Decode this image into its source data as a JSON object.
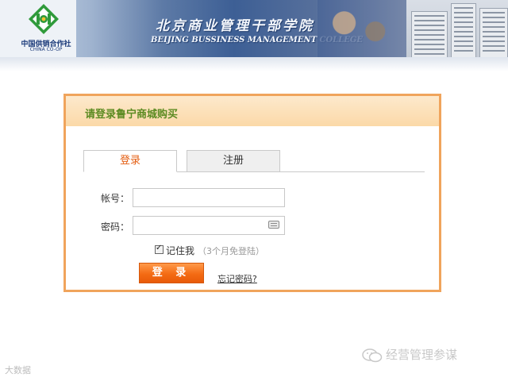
{
  "banner": {
    "coop_name_cn": "中国供销合作社",
    "coop_name_en": "CHINA CO-OP",
    "college_name_cn": "北京商业管理干部学院",
    "college_name_en": "BEIJING BUSSINESS MANAGEMENT COLLEGE"
  },
  "login_panel": {
    "title": "请登录鲁宁商城购买",
    "tabs": [
      {
        "label": "登录",
        "active": true
      },
      {
        "label": "注册",
        "active": false
      }
    ],
    "account_label": "帐号：",
    "account_value": "",
    "password_label": "密码：",
    "password_value": "",
    "remember_label": "记住我",
    "remember_checked": true,
    "remember_hint": "（3个月免登陆）",
    "login_button": "登 录",
    "forgot_link": "忘记密码?"
  },
  "watermarks": {
    "wechat_account": "经营管理参谋",
    "corner_text": "大数据"
  },
  "colors": {
    "panel_border": "#f0a45c",
    "panel_header": "#fde4c2",
    "title_green": "#5c8b22",
    "active_tab_text": "#e45e12",
    "login_button": "#f46b14"
  }
}
